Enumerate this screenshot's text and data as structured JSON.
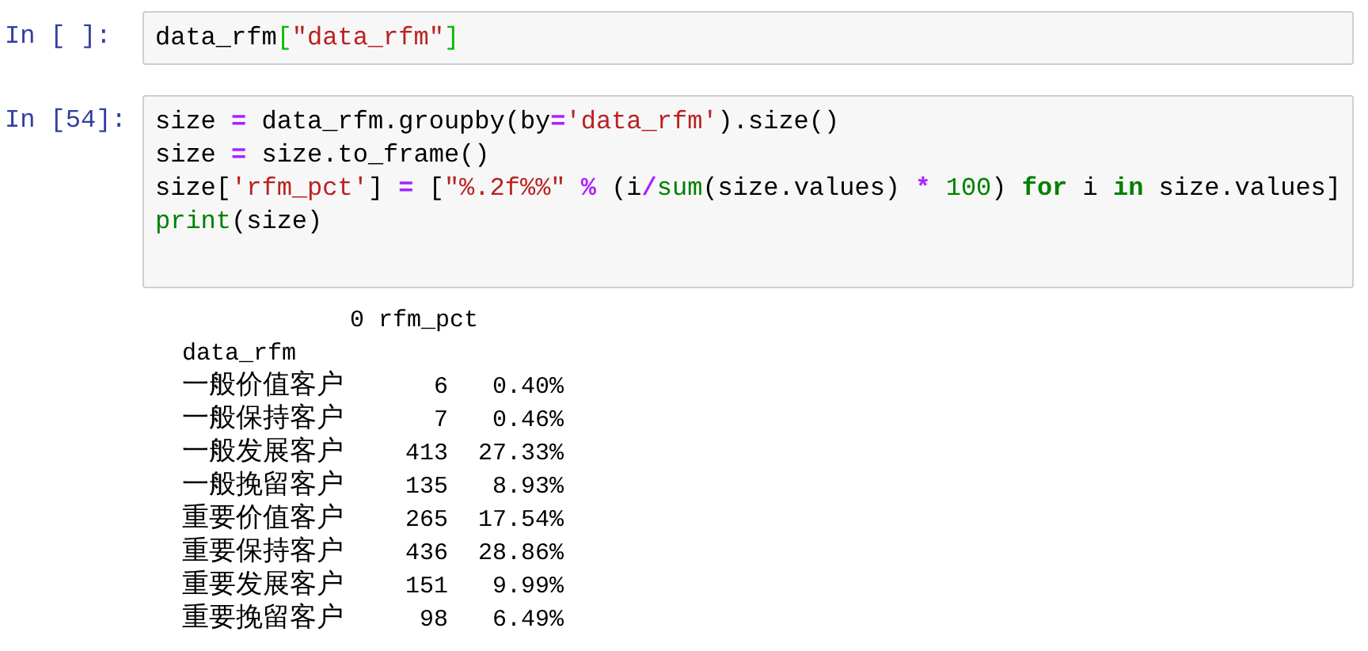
{
  "cells": [
    {
      "prompt": "In [ ]:",
      "lines": [
        [
          {
            "kind": "plain",
            "text": "data_rfm"
          },
          {
            "kind": "bracket",
            "text": "["
          },
          {
            "kind": "string",
            "text": "\"data_rfm\""
          },
          {
            "kind": "bracket",
            "text": "]"
          }
        ]
      ]
    },
    {
      "prompt": "In [54]:",
      "lines": [
        [
          {
            "kind": "plain",
            "text": "size "
          },
          {
            "kind": "operator",
            "text": "="
          },
          {
            "kind": "plain",
            "text": " data_rfm.groupby(by"
          },
          {
            "kind": "operator",
            "text": "="
          },
          {
            "kind": "string",
            "text": "'data_rfm'"
          },
          {
            "kind": "plain",
            "text": ").size()"
          }
        ],
        [
          {
            "kind": "plain",
            "text": "size "
          },
          {
            "kind": "operator",
            "text": "="
          },
          {
            "kind": "plain",
            "text": " size.to_frame()"
          }
        ],
        [
          {
            "kind": "plain",
            "text": "size["
          },
          {
            "kind": "string",
            "text": "'rfm_pct'"
          },
          {
            "kind": "plain",
            "text": "] "
          },
          {
            "kind": "operator",
            "text": "="
          },
          {
            "kind": "plain",
            "text": " ["
          },
          {
            "kind": "string",
            "text": "\"%.2f%%\""
          },
          {
            "kind": "operator",
            "text": " %"
          },
          {
            "kind": "plain",
            "text": " (i"
          },
          {
            "kind": "operator",
            "text": "/"
          },
          {
            "kind": "builtin",
            "text": "sum"
          },
          {
            "kind": "plain",
            "text": "(size.values) "
          },
          {
            "kind": "operator",
            "text": "*"
          },
          {
            "kind": "number",
            "text": " 100"
          },
          {
            "kind": "plain",
            "text": ") "
          },
          {
            "kind": "keyword",
            "text": "for"
          },
          {
            "kind": "plain",
            "text": " i "
          },
          {
            "kind": "keyword",
            "text": "in"
          },
          {
            "kind": "plain",
            "text": " size.values]"
          }
        ],
        [
          {
            "kind": "builtin",
            "text": "print"
          },
          {
            "kind": "plain",
            "text": "(size)"
          }
        ]
      ],
      "output": {
        "header": "0 rfm_pct",
        "index_name": "data_rfm",
        "rows": [
          {
            "label": "一般价值客户",
            "count": "6",
            "pct": "0.40%"
          },
          {
            "label": "一般保持客户",
            "count": "7",
            "pct": "0.46%"
          },
          {
            "label": "一般发展客户",
            "count": "413",
            "pct": "27.33%"
          },
          {
            "label": "一般挽留客户",
            "count": "135",
            "pct": "8.93%"
          },
          {
            "label": "重要价值客户",
            "count": "265",
            "pct": "17.54%"
          },
          {
            "label": "重要保持客户",
            "count": "436",
            "pct": "28.86%"
          },
          {
            "label": "重要发展客户",
            "count": "151",
            "pct": "9.99%"
          },
          {
            "label": "重要挽留客户",
            "count": "98",
            "pct": "6.49%"
          }
        ]
      }
    }
  ]
}
